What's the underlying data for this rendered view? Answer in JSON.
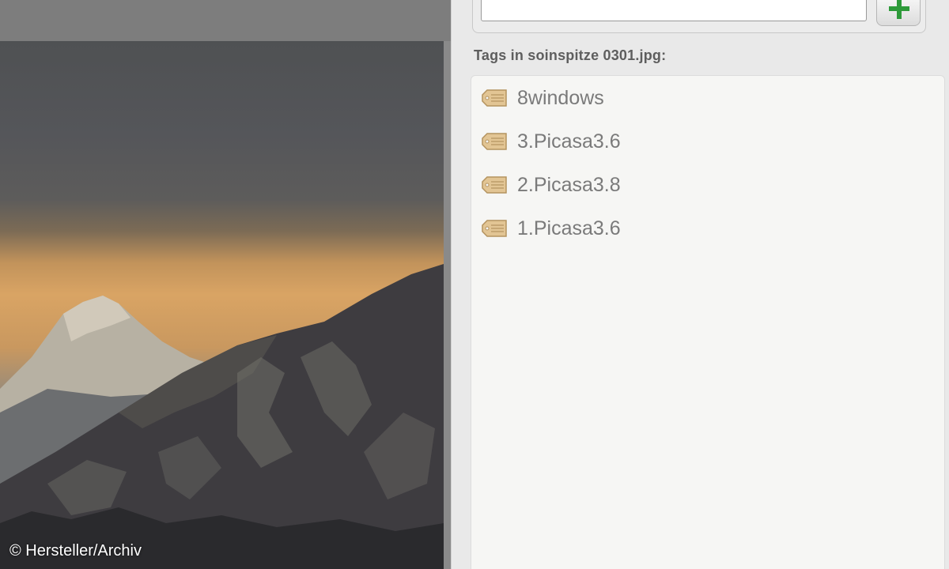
{
  "viewer": {
    "watermark": "© Hersteller/Archiv"
  },
  "tag_panel": {
    "input": {
      "value": "",
      "placeholder": ""
    },
    "add_button_icon": "plus-icon",
    "heading": "Tags in soinspitze 0301.jpg:",
    "tags": [
      {
        "label": "8windows",
        "icon": "tag-icon"
      },
      {
        "label": "3.Picasa3.6",
        "icon": "tag-icon"
      },
      {
        "label": "2.Picasa3.8",
        "icon": "tag-icon"
      },
      {
        "label": "1.Picasa3.6",
        "icon": "tag-icon"
      }
    ]
  },
  "colors": {
    "add_icon_green": "#2e9a3a",
    "tag_icon": "#e2c594"
  }
}
